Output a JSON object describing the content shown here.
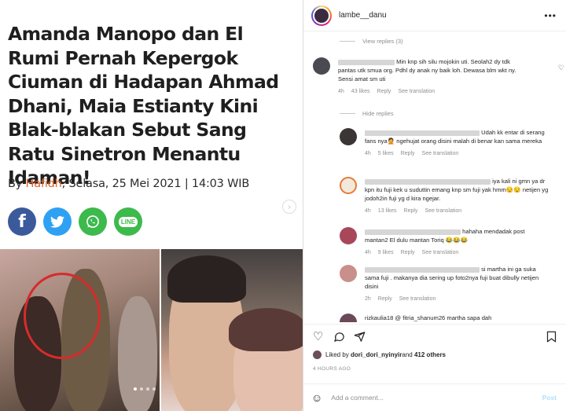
{
  "article": {
    "headline": "Amanda Manopo dan El Rumi Pernah Kepergok Ciuman di Hadapan Ahmad Dhani, Maia Estianty Kini Blak-blakan Sebut Sang Ratu Sinetron Menantu Idaman!",
    "byline_prefix": "By ",
    "author": "Hafidh",
    "date": ", Selasa, 25 Mei 2021 | 14:03 WIB",
    "share": {
      "facebook": "f",
      "line": "LINE"
    }
  },
  "post": {
    "username": "lambe__danu",
    "more": "•••",
    "view_replies": "View replies (3)",
    "hide_replies": "Hide replies",
    "comments": [
      {
        "text": "Min knp sih silu mojokin uti. Seolah2 dy tdk pantas utk smua org. Pdhl dy anak ny baik loh. Dewasa blm wkt ny. Sensi amat sm uti",
        "time": "4h",
        "likes": "43 likes",
        "reply": "Reply",
        "translate": "See translation"
      },
      {
        "text": "Udah kk entar di serang fans nya🤦 ngehujat orang disini malah di benar kan sama mereka",
        "time": "4h",
        "likes": "5 likes",
        "reply": "Reply",
        "translate": "See translation"
      },
      {
        "text": "iya kali ni gmn ya dr kpn itu fuji kek u suduttin emang knp sm fuji yak hmm😒😒 netijen yg jodoh2in fuji yg d kira ngejar.",
        "time": "4h",
        "likes": "13 likes",
        "reply": "Reply",
        "translate": "See translation"
      },
      {
        "text": "hahaha mendadak post mantan2 El dulu mantan Toriq 😂😂😂",
        "time": "4h",
        "likes": "9 likes",
        "reply": "Reply",
        "translate": "See translation"
      },
      {
        "text": "si martha ini ga suka sama fuji . makanya dia sering up foto2nya fuji buat dibully netijen disini",
        "time": "2h",
        "likes": "",
        "reply": "Reply",
        "translate": "See translation"
      },
      {
        "text": "rizkaulia18 @ fitria_shanum26 martha sapa dah",
        "time": "",
        "likes": "",
        "reply": "",
        "translate": ""
      }
    ],
    "liked_prefix": "Liked by ",
    "liked_user": "dori_dori_nyinyir",
    "liked_mid": " and ",
    "liked_count": "412 others",
    "timestamp": "4 HOURS AGO",
    "comment_placeholder": "Add a comment...",
    "post_label": "Post"
  },
  "colors": {
    "author": "#e0612a",
    "facebook": "#3a5a9b",
    "twitter": "#2ea1f2",
    "whatsapp": "#3cba4c",
    "line": "#3cba4c",
    "post_button": "#b2dffc"
  }
}
